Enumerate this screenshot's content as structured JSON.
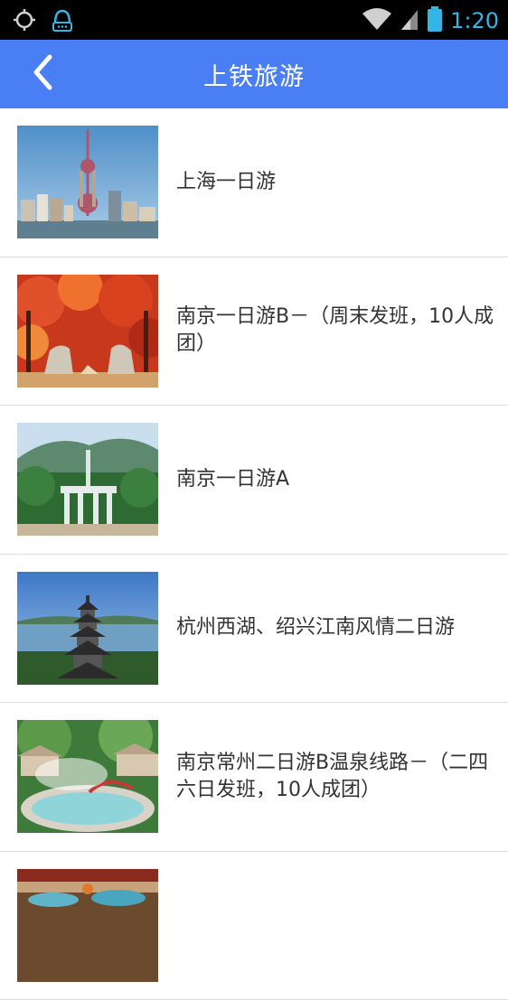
{
  "status_bar": {
    "time": "1:20",
    "icons": [
      "gps-icon",
      "notification-icon",
      "wifi-icon",
      "signal-icon",
      "battery-icon"
    ]
  },
  "app_bar": {
    "back_icon": "chevron-left-icon",
    "title": "上铁旅游"
  },
  "colors": {
    "app_bar": "#4a7ef5",
    "status_accent": "#33b5e5",
    "divider": "#dcdcdc",
    "item_text": "#333333"
  },
  "tours": [
    {
      "title": "上海一日游",
      "image": "shanghai-skyline-image"
    },
    {
      "title": "南京一日游B－（周末发班，10人成团）",
      "image": "autumn-maple-stone-animals-image"
    },
    {
      "title": "南京一日游A",
      "image": "mausoleum-archway-image"
    },
    {
      "title": "杭州西湖、绍兴江南风情二日游",
      "image": "pagoda-lake-image"
    },
    {
      "title": " 南京常州二日游B温泉线路－（二四六日发班，10人成团）",
      "image": "hot-spring-pool-image"
    },
    {
      "title": "",
      "image": "resort-pool-image"
    }
  ]
}
